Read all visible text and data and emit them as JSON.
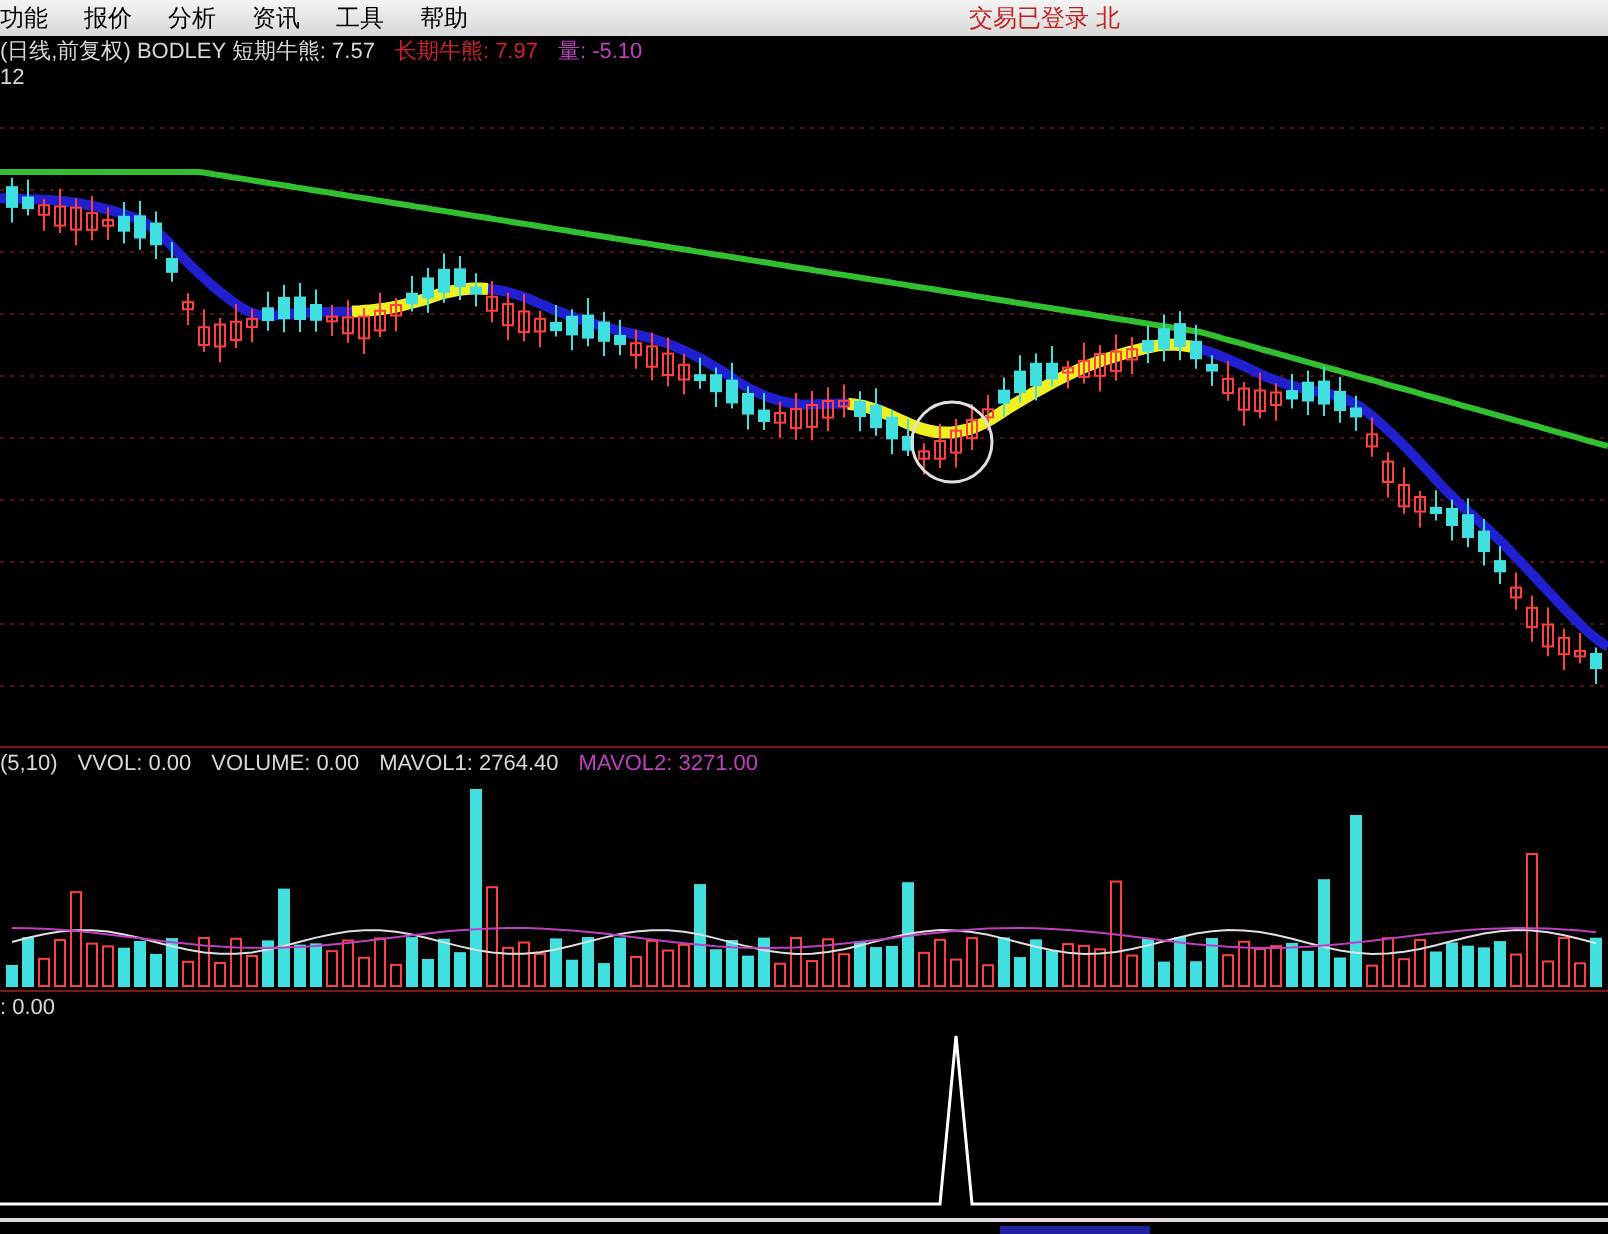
{
  "menu": {
    "items": [
      "功能",
      "报价",
      "分析",
      "资讯",
      "工具",
      "帮助"
    ],
    "status": "交易已登录 北"
  },
  "price_panel": {
    "legend": [
      {
        "text": "(日线,前复权) BODLEY 短期牛熊: 7.57",
        "color": "#d8d8d8"
      },
      {
        "text": "长期牛熊: 7.97",
        "color": "#d02030"
      },
      {
        "text": "量: -5.10",
        "color": "#c040c0"
      }
    ],
    "scale_label": "12"
  },
  "volume_panel": {
    "legend": [
      {
        "text": "(5,10)",
        "color": "#d8d8d8"
      },
      {
        "text": "VVOL: 0.00",
        "color": "#d8d8d8"
      },
      {
        "text": "VOLUME: 0.00",
        "color": "#d8d8d8"
      },
      {
        "text": "MAVOL1: 2764.40",
        "color": "#d8d8d8"
      },
      {
        "text": "MAVOL2: 3271.00",
        "color": "#c040c0"
      }
    ]
  },
  "indicator_panel": {
    "legend": [
      {
        "text": ": 0.00",
        "color": "#d8d8d8"
      }
    ]
  }
}
